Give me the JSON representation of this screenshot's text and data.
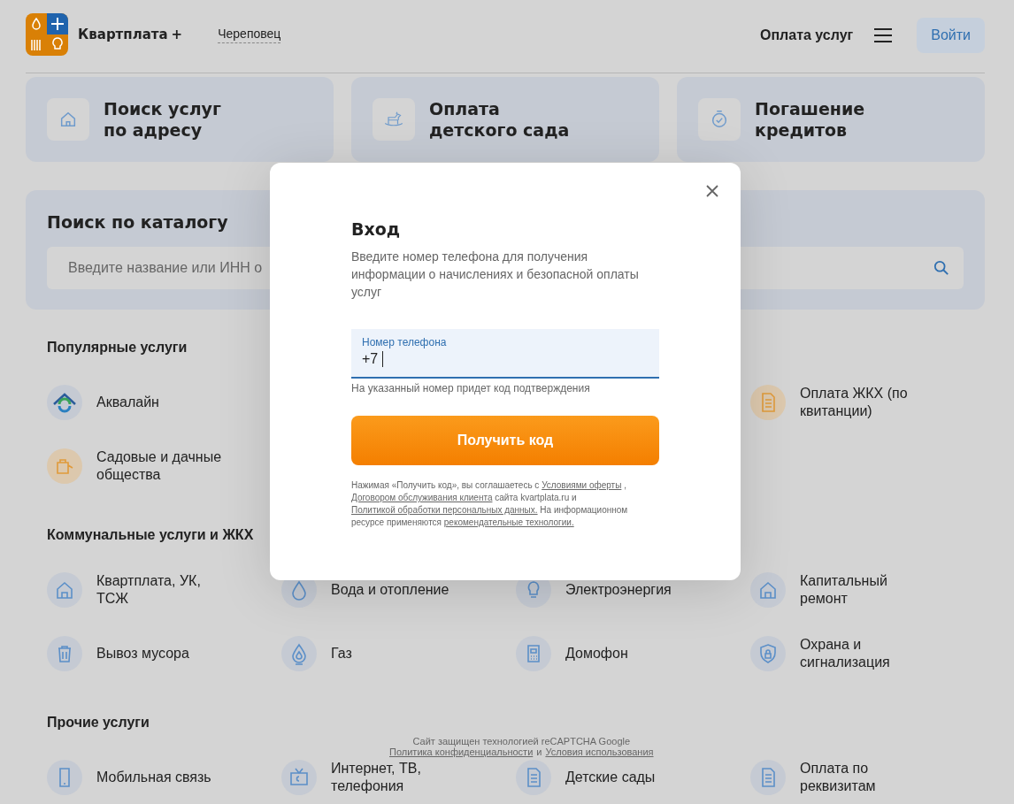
{
  "header": {
    "brand": "Квартплата",
    "brand_mark": "+",
    "city": "Череповец",
    "nav_link": "Оплата услуг",
    "login_button": "Войти"
  },
  "quick_cards": [
    {
      "title_line_1": "Поиск услуг",
      "title_line_2": "по адресу"
    },
    {
      "title_line_1": "Оплата",
      "title_line_2": "детского сада"
    },
    {
      "title_line_1": "Погашение",
      "title_line_2": "кредитов"
    }
  ],
  "catalog_search": {
    "title": "Поиск по каталогу",
    "placeholder": "Введите название или ИНН о"
  },
  "sections": [
    {
      "title": "Популярные услуги",
      "column_1": [
        {
          "label": "Аквалайн"
        },
        {
          "label": "Садовые и дачные общества"
        }
      ],
      "column_4": [
        {
          "label": "Оплата ЖКХ (по квитанции)"
        }
      ]
    },
    {
      "title": "Коммунальные услуги и ЖКХ",
      "column_1": [
        {
          "label": "Квартплата, УК, ТСЖ"
        },
        {
          "label": "Вывоз мусора"
        }
      ],
      "column_2": [
        {
          "label": "Вода и отопление"
        },
        {
          "label": "Газ"
        }
      ],
      "column_3": [
        {
          "label": "Электроэнергия"
        },
        {
          "label": "Домофон"
        }
      ],
      "column_4": [
        {
          "label": "Капитальный ремонт"
        },
        {
          "label": "Охрана и сигнализация"
        }
      ]
    },
    {
      "title": "Прочие услуги",
      "column_1": [
        {
          "label": "Мобильная связь"
        }
      ],
      "column_2": [
        {
          "label": "Интернет, ТВ, телефония"
        }
      ],
      "column_3": [
        {
          "label": "Детские сады"
        }
      ],
      "column_4": [
        {
          "label": "Оплата по реквизитам"
        }
      ]
    }
  ],
  "login_modal": {
    "title": "Вход",
    "description": "Введите номер телефона для получения информации о начислениях и безопасной оплаты услуг",
    "phone_field": {
      "label": "Номер телефона",
      "value": "+7"
    },
    "hint": "На указанный номер придет код подтверждения",
    "submit_button": "Получить код",
    "legal": [
      {
        "text": "Нажимая «Получить код», вы соглашаетесь с",
        "link": false
      },
      {
        "text": "Условиями оферты",
        "link": true
      },
      {
        "text": ",",
        "link": false
      },
      {
        "text": "Договором обслуживания клиента",
        "link": true
      },
      {
        "text": "сайта kvartplata.ru и",
        "link": false
      },
      {
        "text": "Политикой обработки персональных данных.",
        "link": true
      },
      {
        "text": "На информационном ресурсе применяются",
        "link": false
      },
      {
        "text": "рекомендательные технологии.",
        "link": true
      }
    ]
  },
  "recaptcha": {
    "text": "Сайт защищен технологией reCAPTCHA Google",
    "privacy_link": "Политика конфиденциальности",
    "conjunction": "и",
    "terms_link": "Условия использования"
  }
}
